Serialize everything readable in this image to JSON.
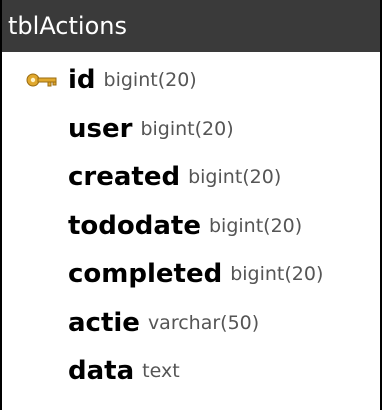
{
  "table": {
    "name": "tblActions",
    "colors": {
      "header_bg": "#3a3a3a",
      "header_text": "#ffffff",
      "type_text": "#555555",
      "key_icon": "#e0a82e"
    },
    "columns": [
      {
        "name": "id",
        "type": "bigint(20)",
        "primary_key": true,
        "icon": "key-icon"
      },
      {
        "name": "user",
        "type": "bigint(20)"
      },
      {
        "name": "created",
        "type": "bigint(20)"
      },
      {
        "name": "tododate",
        "type": "bigint(20)"
      },
      {
        "name": "completed",
        "type": "bigint(20)"
      },
      {
        "name": "actie",
        "type": "varchar(50)"
      },
      {
        "name": "data",
        "type": "text"
      }
    ]
  }
}
